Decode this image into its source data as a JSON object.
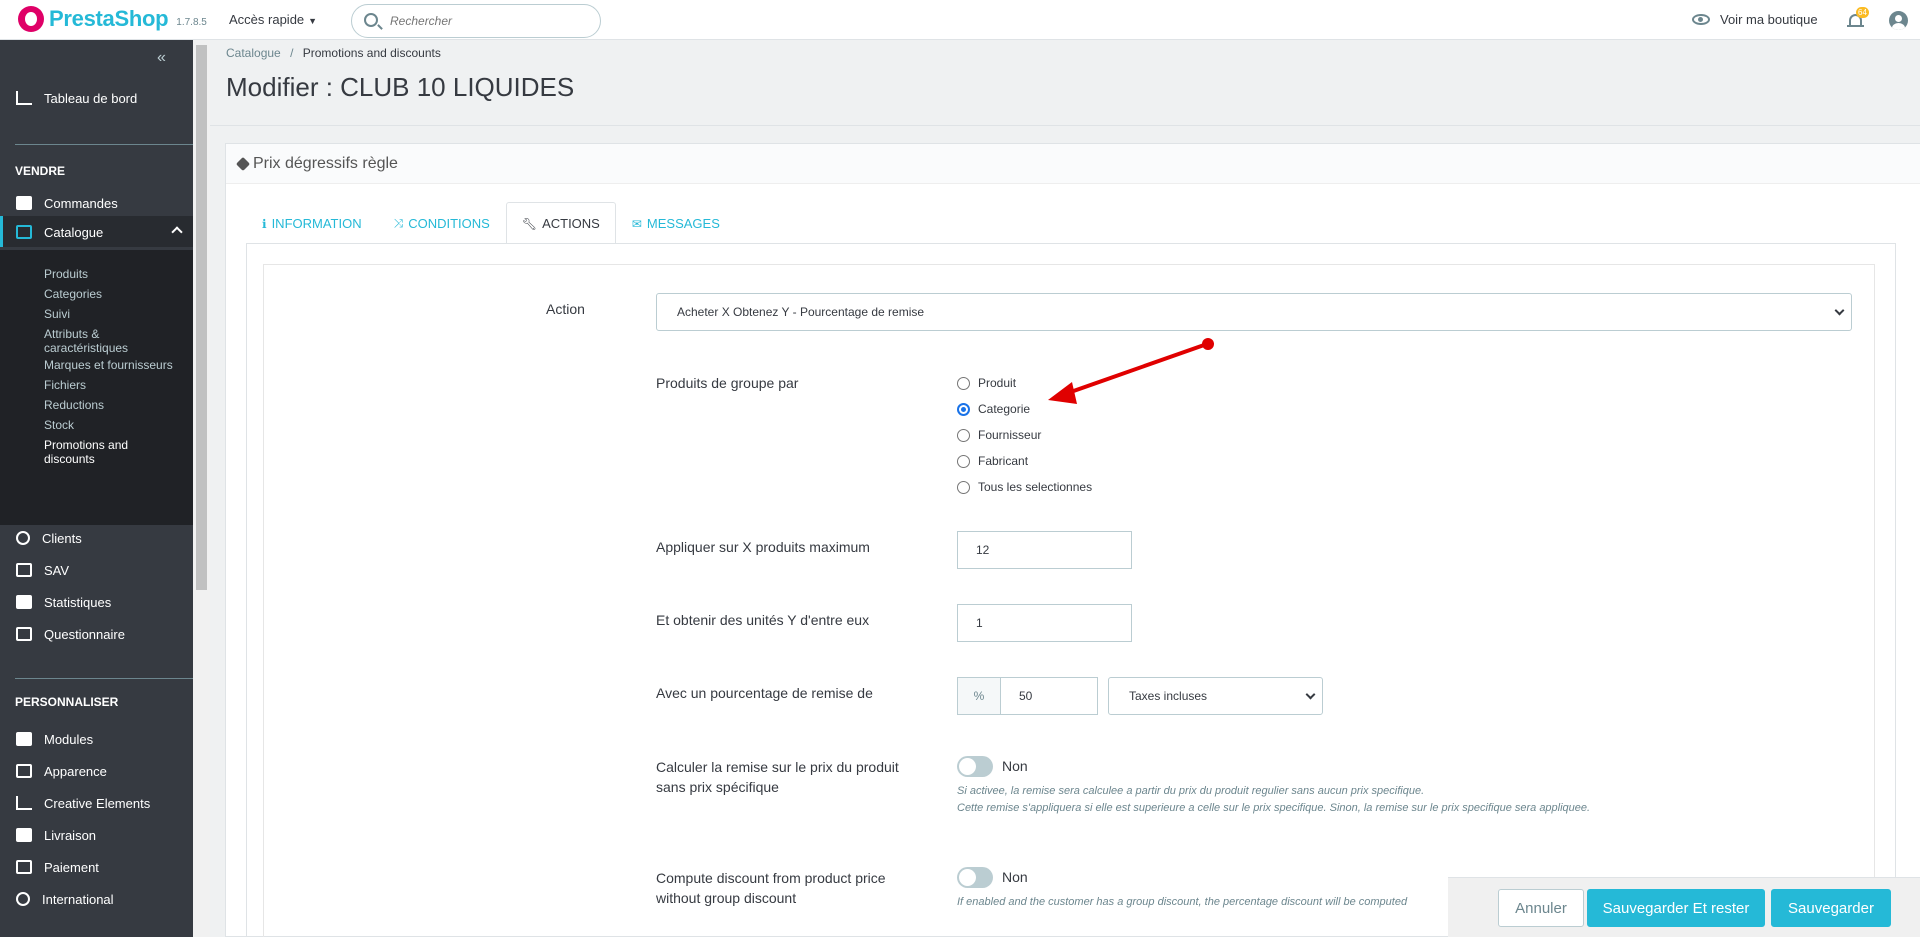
{
  "topbar": {
    "brand": "PrestaShop",
    "version": "1.7.8.5",
    "quick_access": "Accès rapide",
    "search_placeholder": "Rechercher",
    "view_shop": "Voir ma boutique",
    "notifications_count": "64"
  },
  "sidebar": {
    "dashboard": "Tableau de bord",
    "section_sell": "VENDRE",
    "orders": "Commandes",
    "catalog": "Catalogue",
    "catalog_sub": [
      "Produits",
      "Categories",
      "Suivi",
      "Attributs & caractéristiques",
      "Marques et fournisseurs",
      "Fichiers",
      "Reductions",
      "Stock",
      "Promotions and discounts"
    ],
    "clients": "Clients",
    "sav": "SAV",
    "stats": "Statistiques",
    "questionnaire": "Questionnaire",
    "section_customize": "PERSONNALISER",
    "modules": "Modules",
    "appearance": "Apparence",
    "creative": "Creative Elements",
    "shipping": "Livraison",
    "payment": "Paiement",
    "international": "International"
  },
  "breadcrumb": {
    "parent": "Catalogue",
    "sep": "/",
    "current": "Promotions and discounts"
  },
  "page_title": "Modifier : CLUB 10 LIQUIDES",
  "panel": {
    "heading": "Prix dégressifs règle",
    "tabs": [
      "INFORMATION",
      "CONDITIONS",
      "ACTIONS",
      "MESSAGES"
    ],
    "active_tab": "ACTIONS"
  },
  "form": {
    "action_label": "Action",
    "action_value": "Acheter X Obtenez Y - Pourcentage de remise",
    "group_label": "Produits de groupe par",
    "group_options": [
      "Produit",
      "Categorie",
      "Fournisseur",
      "Fabricant",
      "Tous les selectionnes"
    ],
    "group_selected": "Categorie",
    "max_label": "Appliquer sur X produits maximum",
    "max_value": "12",
    "units_label": "Et obtenir des unités Y d'entre eux",
    "units_value": "1",
    "percent_label": "Avec un pourcentage de remise de",
    "percent_addon": "%",
    "percent_value": "50",
    "tax_value": "Taxes incluses",
    "calc_label_1": "Calculer la remise sur le prix du produit",
    "calc_label_2": "sans prix spécifique",
    "calc_toggle": "Non",
    "calc_help_1": "Si activee, la remise sera calculee a partir du prix du produit regulier sans aucun prix specifique.",
    "calc_help_2": "Cette remise s'appliquera si elle est superieure a celle sur le prix specifique. Sinon, la remise sur le prix specifique sera appliquee.",
    "group_disc_label_1": "Compute discount from product price",
    "group_disc_label_2": "without group discount",
    "group_disc_toggle": "Non",
    "group_disc_help": "If enabled and the customer has a group discount, the percentage discount will be computed"
  },
  "footer": {
    "cancel": "Annuler",
    "save_stay": "Sauvegarder Et rester",
    "save": "Sauvegarder"
  },
  "colors": {
    "accent": "#25b9d7",
    "sidebar": "#363a41",
    "arrow": "#e00000"
  }
}
